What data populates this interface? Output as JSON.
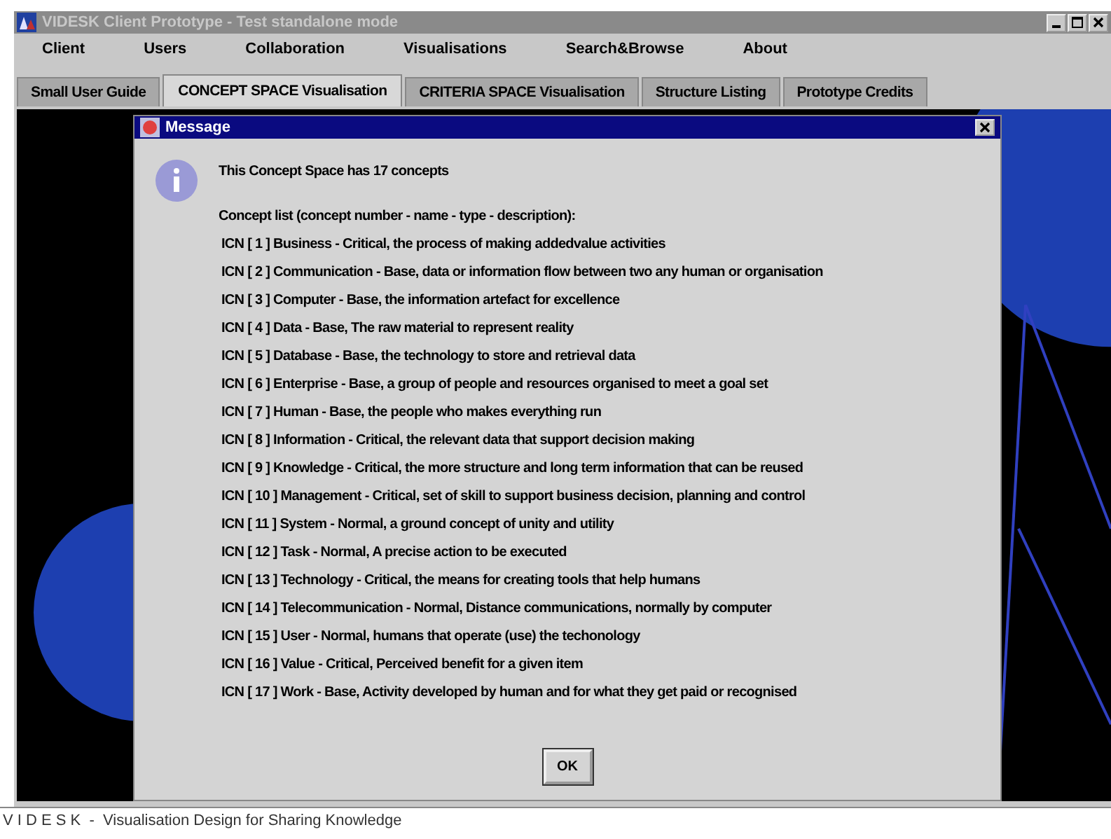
{
  "window": {
    "title": "VIDESK Client Prototype - Test standalone mode"
  },
  "menu": [
    "Client",
    "Users",
    "Collaboration",
    "Visualisations",
    "Search&Browse",
    "About"
  ],
  "tabs": [
    {
      "label": "Small User Guide",
      "selected": false
    },
    {
      "label": "CONCEPT SPACE Visualisation",
      "selected": true
    },
    {
      "label": "CRITERIA SPACE Visualisation",
      "selected": false
    },
    {
      "label": "Structure Listing",
      "selected": false
    },
    {
      "label": "Prototype Credits",
      "selected": false
    }
  ],
  "dialog": {
    "title": "Message",
    "headline": "This Concept Space has 17 concepts",
    "list_heading": "Concept list (concept number - name - type - description):",
    "concepts": [
      "ICN [ 1 ] Business - Critical, the process of making addedvalue activities",
      "ICN [ 2 ] Communication - Base, data or information flow between two any human or organisation",
      "ICN [ 3 ] Computer - Base, the information artefact for excellence",
      "ICN [ 4 ] Data - Base, The raw material to represent reality",
      "ICN [ 5 ] Database - Base, the technology to store and retrieval data",
      "ICN [ 6 ] Enterprise - Base, a group of people and resources organised to meet a goal set",
      "ICN [ 7 ] Human - Base, the people who makes everything run",
      "ICN [ 8 ] Information - Critical, the relevant data that support decision making",
      "ICN [ 9 ] Knowledge - Critical, the more structure and long term information that can be reused",
      "ICN [ 10 ] Management - Critical, set of skill to support business decision, planning and control",
      "ICN [ 11 ] System - Normal, a ground concept of unity and utility",
      "ICN [ 12 ] Task - Normal, A precise action to be executed",
      "ICN [ 13 ] Technology - Critical, the means for creating tools that help humans",
      "ICN [ 14 ] Telecommunication - Normal, Distance communications, normally by computer",
      "ICN [ 15 ] User - Normal, humans that operate (use) the techonology",
      "ICN [ 16 ] Value - Critical, Perceived benefit for a given item",
      "ICN [ 17 ] Work - Base, Activity developed by human and for what they get paid or recognised"
    ],
    "button": "OK"
  },
  "status_bar": "V I D E S K  -  Visualisation Design for Sharing Knowledge"
}
